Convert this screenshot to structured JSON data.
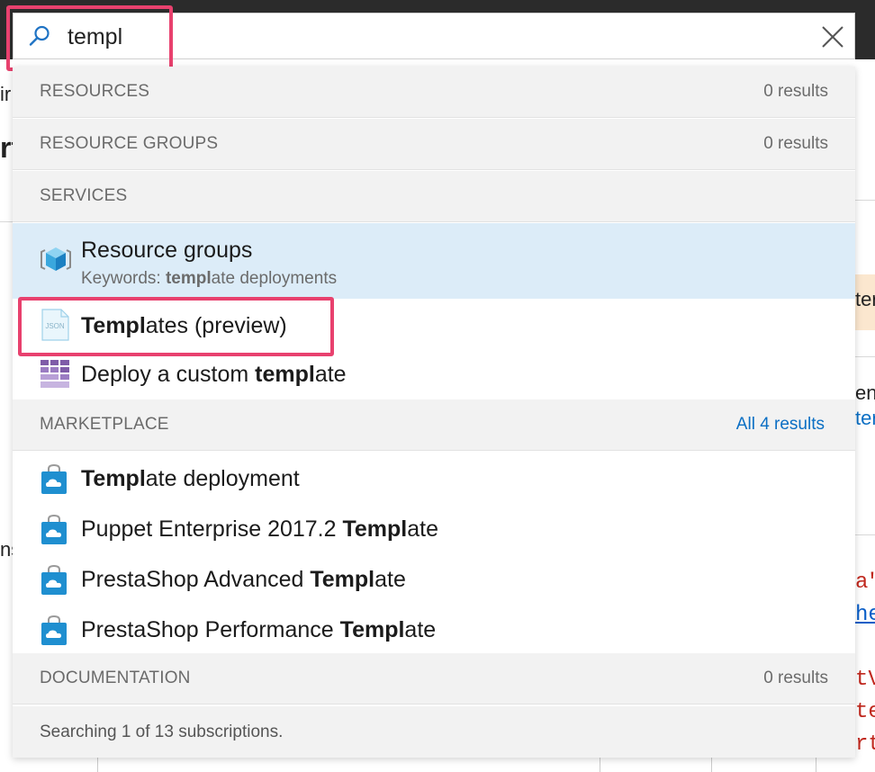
{
  "search": {
    "query": "templ",
    "clear_icon": "close-icon",
    "search_icon": "search-icon"
  },
  "background": {
    "left_fragments": [
      "ir",
      "rt",
      "ns"
    ],
    "right_fragments": [
      "ter",
      "en",
      "ter",
      "a\"",
      "he",
      "tV",
      "te",
      "rt"
    ]
  },
  "sections": {
    "resources": {
      "title": "RESOURCES",
      "count": "0 results"
    },
    "resource_groups": {
      "title": "RESOURCE GROUPS",
      "count": "0 results"
    },
    "services": {
      "title": "SERVICES"
    },
    "marketplace": {
      "title": "MARKETPLACE",
      "link": "All 4 results"
    },
    "documentation": {
      "title": "DOCUMENTATION",
      "count": "0 results"
    }
  },
  "services_items": [
    {
      "label": "Resource groups",
      "sub_prefix": "Keywords: ",
      "sub_bold": "templ",
      "sub_suffix": "ate deployments",
      "icon": "resource-group-cube-icon",
      "selected": true
    },
    {
      "bold": "Templ",
      "suffix": "ates (preview)",
      "icon": "json-file-icon",
      "icon_text": "JSON"
    },
    {
      "prefix": "Deploy a custom ",
      "bold": "templ",
      "suffix": "ate",
      "icon": "custom-template-grid-icon"
    }
  ],
  "marketplace_items": [
    {
      "prefix": "",
      "bold": "Templ",
      "suffix": "ate deployment",
      "icon": "marketplace-bag-icon"
    },
    {
      "prefix": "Puppet Enterprise 2017.2 ",
      "bold": "Templ",
      "suffix": "ate",
      "icon": "marketplace-bag-icon"
    },
    {
      "prefix": "PrestaShop Advanced ",
      "bold": "Templ",
      "suffix": "ate",
      "icon": "marketplace-bag-icon"
    },
    {
      "prefix": "PrestaShop Performance ",
      "bold": "Templ",
      "suffix": "ate",
      "icon": "marketplace-bag-icon"
    }
  ],
  "footer": {
    "text": "Searching 1 of 13 subscriptions."
  },
  "colors": {
    "highlight": "#e8416e",
    "selected_row": "#dcecf8",
    "section_bg": "#f2f2f2",
    "link": "#0b6fc4",
    "topbar": "#2b2b2b"
  }
}
